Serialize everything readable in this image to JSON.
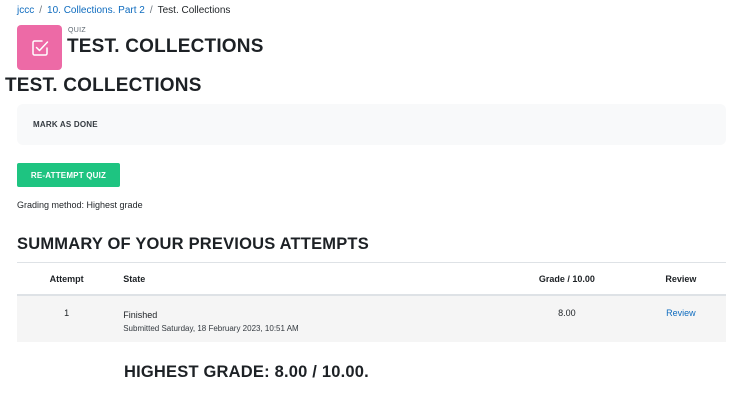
{
  "breadcrumb": {
    "items": [
      "jccc",
      "10. Collections. Part 2",
      "Test. Collections"
    ],
    "separator": "/"
  },
  "activity": {
    "icon": "quiz-checkbox-icon",
    "icon_color": "#ed6aa6",
    "module_type": "QUIZ",
    "title": "TEST. COLLECTIONS"
  },
  "secondary_title": "TEST. COLLECTIONS",
  "completion": {
    "mark_done_label": "MARK AS DONE"
  },
  "reattempt_label": "RE-ATTEMPT QUIZ",
  "reattempt_color": "#1ec481",
  "grading_method": "Grading method: Highest grade",
  "summary_heading": "SUMMARY OF YOUR PREVIOUS ATTEMPTS",
  "attempts_table": {
    "headers": [
      "Attempt",
      "State",
      "Grade / 10.00",
      "Review"
    ],
    "rows": [
      {
        "attempt": "1",
        "state": "Finished",
        "submitted": "Submitted Saturday, 18 February 2023, 10:51 AM",
        "grade": "8.00",
        "review": "Review"
      }
    ]
  },
  "highest_grade": "HIGHEST GRADE: 8.00 / 10.00."
}
